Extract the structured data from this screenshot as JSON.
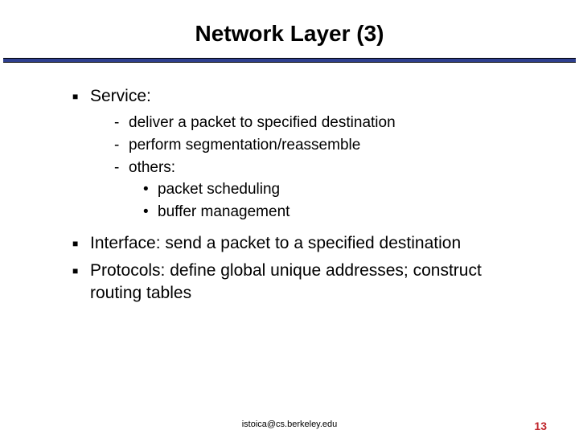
{
  "title": "Network Layer (3)",
  "bullets": {
    "service_label": "Service:",
    "service_items": {
      "a": "deliver a packet to specified destination",
      "b": "perform segmentation/reassemble",
      "c": "others:",
      "c1": "packet scheduling",
      "c2": "buffer management"
    },
    "interface": "Interface: send a packet to a specified destination",
    "protocols": "Protocols: define global unique addresses; construct routing tables"
  },
  "footer": {
    "email": "istoica@cs.berkeley.edu",
    "page": "13"
  }
}
